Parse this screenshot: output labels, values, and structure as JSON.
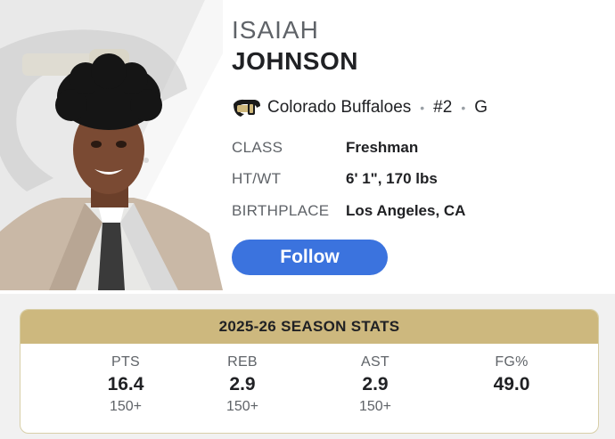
{
  "player": {
    "first_name": "ISAIAH",
    "last_name": "JOHNSON",
    "team": "Colorado Buffaloes",
    "number": "#2",
    "position": "G",
    "team_logo_icon": "colorado-buffaloes-logo-icon"
  },
  "attributes": [
    {
      "label": "CLASS",
      "value": "Freshman"
    },
    {
      "label": "HT/WT",
      "value": "6' 1\", 170 lbs"
    },
    {
      "label": "BIRTHPLACE",
      "value": "Los Angeles, CA"
    }
  ],
  "follow_label": "Follow",
  "stats": {
    "title": "2025-26 SEASON STATS",
    "items": [
      {
        "label": "PTS",
        "value": "16.4",
        "rank": "150+"
      },
      {
        "label": "REB",
        "value": "2.9",
        "rank": "150+"
      },
      {
        "label": "AST",
        "value": "2.9",
        "rank": "150+"
      },
      {
        "label": "FG%",
        "value": "49.0",
        "rank": ""
      }
    ]
  },
  "colors": {
    "accent": "#3b73de",
    "stats_header": "#cdb87e",
    "team_gold": "#cfb87c"
  }
}
